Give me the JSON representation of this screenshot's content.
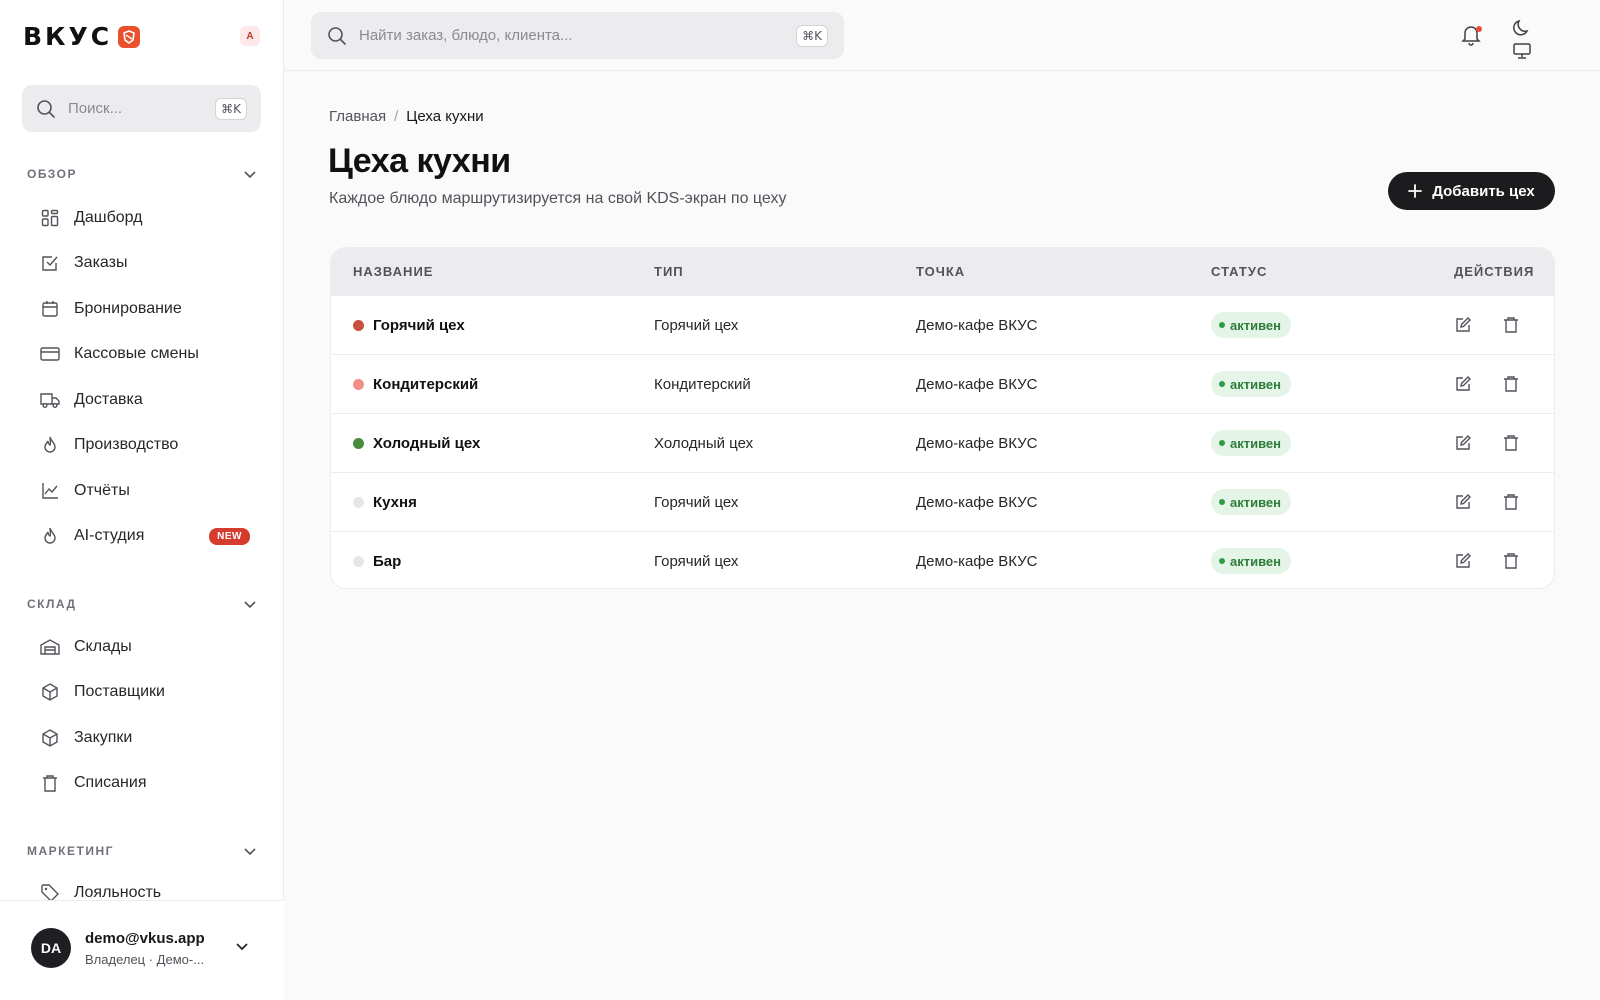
{
  "brand": {
    "name": "ВКУС",
    "workspace_badge": "A",
    "accent": "#e8512b"
  },
  "sidebar": {
    "search": {
      "placeholder": "Поиск...",
      "shortcut": "⌘K"
    },
    "sections": [
      {
        "title": "ОБЗОР",
        "items": [
          {
            "label": "Дашборд",
            "icon": "dashboard-icon"
          },
          {
            "label": "Заказы",
            "icon": "checklist-icon"
          },
          {
            "label": "Бронирование",
            "icon": "calendar-icon"
          },
          {
            "label": "Кассовые смены",
            "icon": "card-icon"
          },
          {
            "label": "Доставка",
            "icon": "truck-icon"
          },
          {
            "label": "Производство",
            "icon": "flame-icon"
          },
          {
            "label": "Отчёты",
            "icon": "chart-line-icon"
          },
          {
            "label": "AI-студия",
            "icon": "flame-icon",
            "badge": "NEW"
          }
        ]
      },
      {
        "title": "СКЛАД",
        "items": [
          {
            "label": "Склады",
            "icon": "warehouse-icon"
          },
          {
            "label": "Поставщики",
            "icon": "box-icon"
          },
          {
            "label": "Закупки",
            "icon": "box-icon"
          },
          {
            "label": "Списания",
            "icon": "trash-icon"
          }
        ]
      },
      {
        "title": "МАРКЕТИНГ",
        "items": [
          {
            "label": "Лояльность",
            "icon": "tag-icon"
          }
        ]
      }
    ],
    "user": {
      "initials": "DA",
      "email": "demo@vkus.app",
      "role": "Владелец · Демо-..."
    }
  },
  "topbar": {
    "search": {
      "placeholder": "Найти заказ, блюдо, клиента...",
      "shortcut": "⌘K"
    }
  },
  "breadcrumb": {
    "home": "Главная",
    "separator": "/",
    "current": "Цеха кухни"
  },
  "page": {
    "title": "Цеха кухни",
    "subtitle": "Каждое блюдо маршрутизируется на свой KDS-экран по цеху",
    "add_button": "Добавить цех"
  },
  "table": {
    "columns": [
      "НАЗВАНИЕ",
      "ТИП",
      "ТОЧКА",
      "СТАТУС",
      "ДЕЙСТВИЯ"
    ],
    "rows": [
      {
        "name": "Горячий цех",
        "type": "Горячий цех",
        "point": "Демо-кафе ВКУС",
        "status": "активен",
        "color": "#c8503e"
      },
      {
        "name": "Кондитерский",
        "type": "Кондитерский",
        "point": "Демо-кафе ВКУС",
        "status": "активен",
        "color": "#f08f87"
      },
      {
        "name": "Холодный цех",
        "type": "Холодный цех",
        "point": "Демо-кафе ВКУС",
        "status": "активен",
        "color": "#4a8a3b"
      },
      {
        "name": "Кухня",
        "type": "Горячий цех",
        "point": "Демо-кафе ВКУС",
        "status": "активен",
        "color": "#e6e6e9"
      },
      {
        "name": "Бар",
        "type": "Горячий цех",
        "point": "Демо-кафе ВКУС",
        "status": "активен",
        "color": "#e6e6e9"
      }
    ]
  }
}
